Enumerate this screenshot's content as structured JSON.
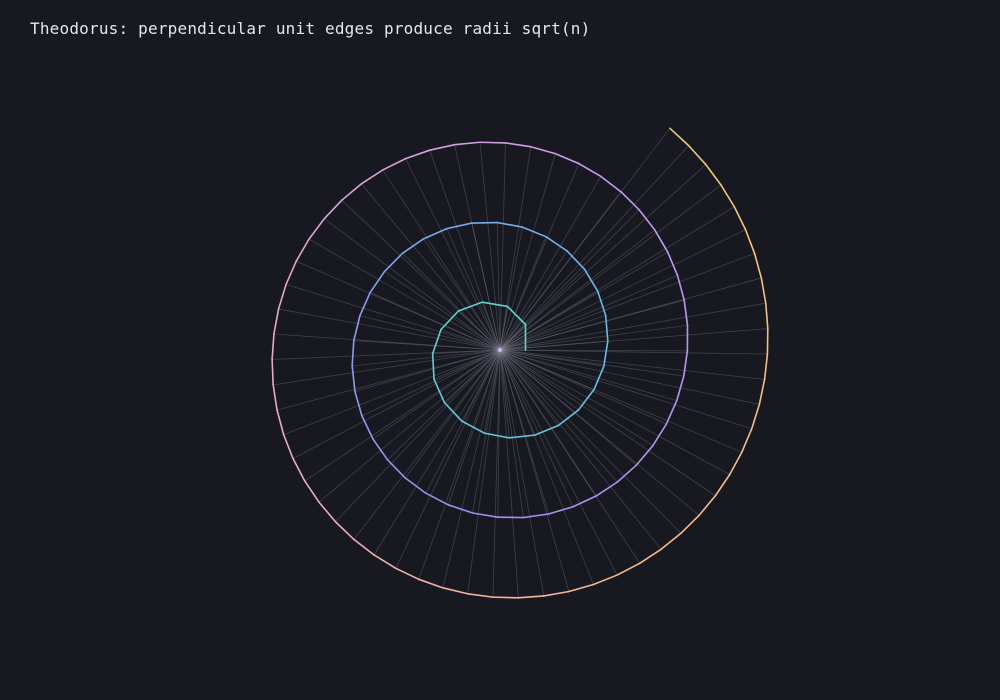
{
  "title": "Theodorus: perpendicular unit edges produce radii sqrt(n)",
  "spiral": {
    "triangle_count": 119,
    "edge_length": 1,
    "radius_rule": "sqrt(n)",
    "rotation": "counterclockwise",
    "color_gradient": [
      "#5fd8c8",
      "#6fb4e8",
      "#9a8ff0",
      "#c79af0",
      "#e8a8c8",
      "#f4b890",
      "#f0c878"
    ],
    "spoke_color": "#8a8a9a",
    "center_color": "#c8b8f0",
    "background": "#181920"
  }
}
